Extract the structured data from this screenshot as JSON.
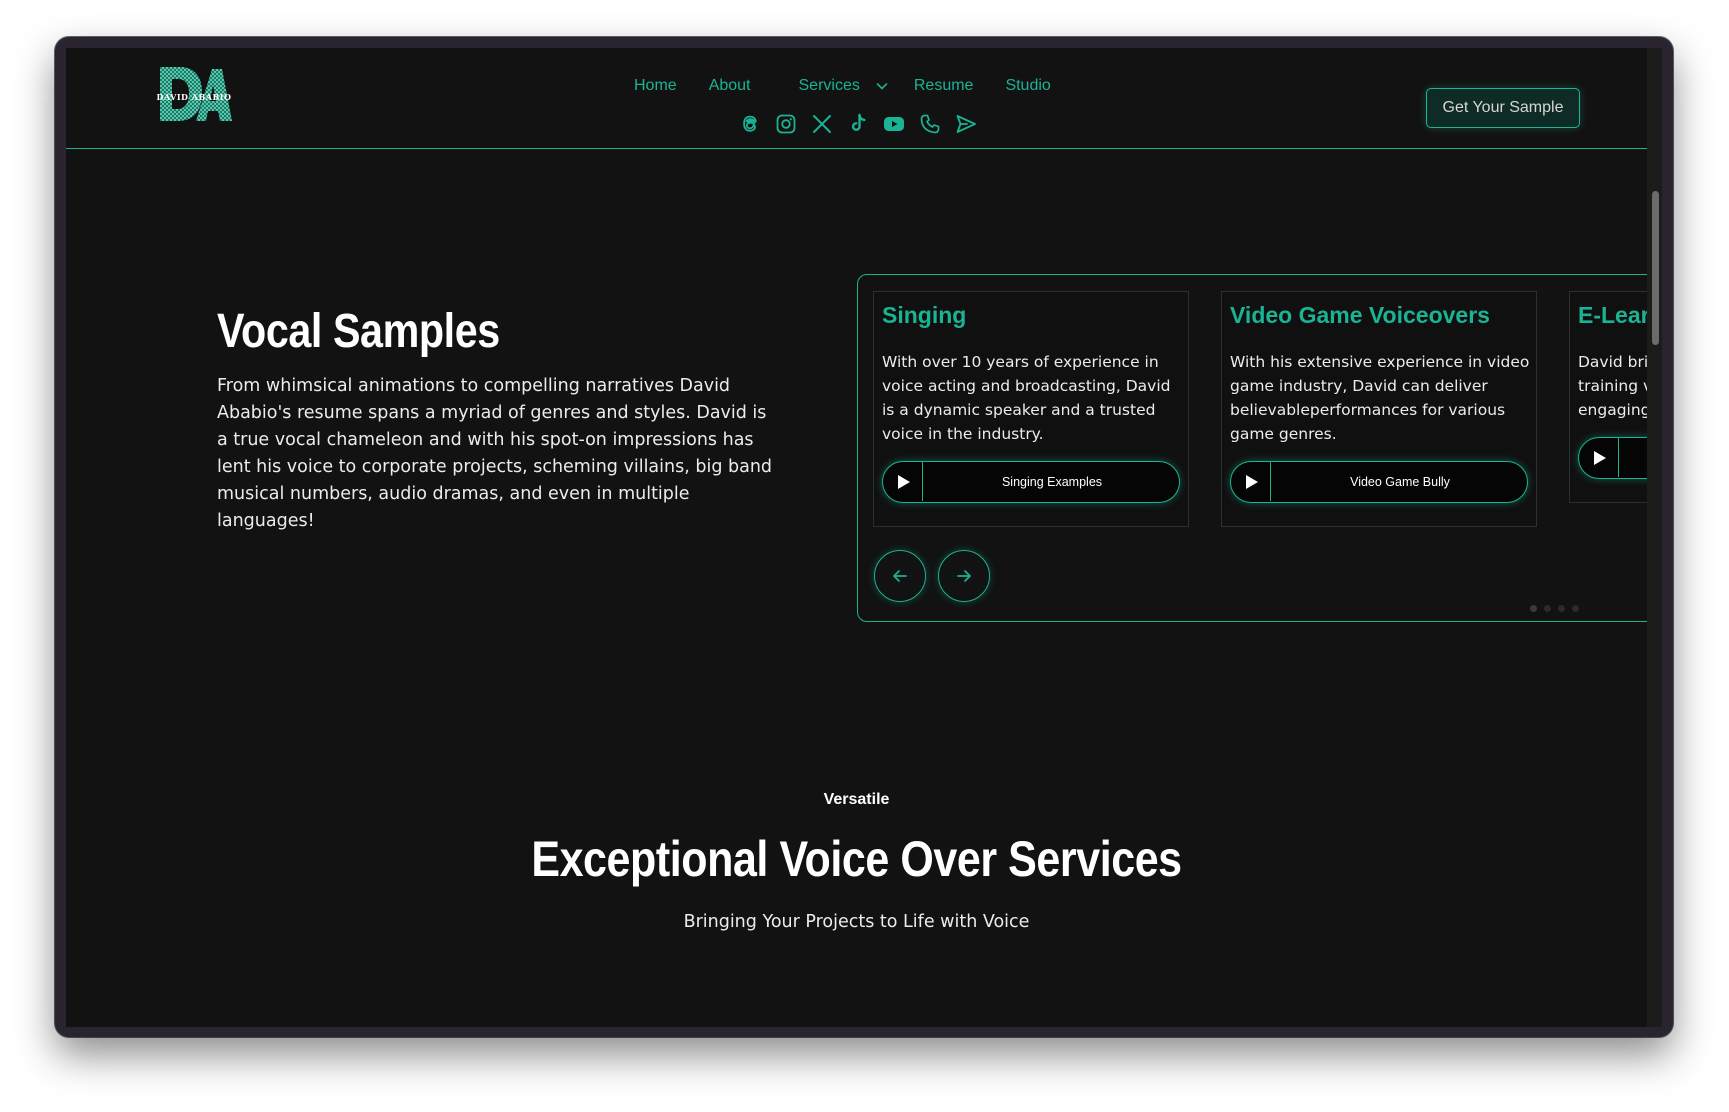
{
  "header": {
    "logo_text": "DAVID ABABIO",
    "nav": {
      "home": "Home",
      "about": "About",
      "services": "Services",
      "resume": "Resume",
      "studio": "Studio"
    },
    "socials": [
      "threads-icon",
      "instagram-icon",
      "x-icon",
      "tiktok-icon",
      "youtube-icon",
      "phone-icon",
      "send-icon"
    ],
    "cta_label": "Get Your Sample"
  },
  "hero": {
    "title": "Vocal Samples",
    "body": "From whimsical animations to compelling narratives David Ababio's resume spans a myriad of genres and styles. David is a true vocal chameleon and with his spot-on impressions has lent his voice to corporate projects, scheming villains, big band musical numbers, audio dramas, and even in multiple languages!"
  },
  "carousel": {
    "cards": [
      {
        "title": "Singing",
        "text": "With over 10 years of experience in voice acting and broadcasting, David is a dynamic speaker and a trusted voice in the industry.",
        "audio_label": "Singing Examples"
      },
      {
        "title": "Video Game Voiceovers",
        "text": "With his extensive experience in video game industry, David can deliver believableperformances for various game genres.",
        "audio_label": "Video Game Bully"
      },
      {
        "title": "E-Lear",
        "text": "David bri training v engaging",
        "audio_label": ""
      }
    ],
    "dot_count": 4
  },
  "services": {
    "eyebrow": "Versatile",
    "title": "Exceptional Voice Over Services",
    "subtitle": "Bringing Your Projects to Life with Voice"
  },
  "colors": {
    "accent": "#1ab394",
    "background": "#121212",
    "text": "#ececec"
  }
}
